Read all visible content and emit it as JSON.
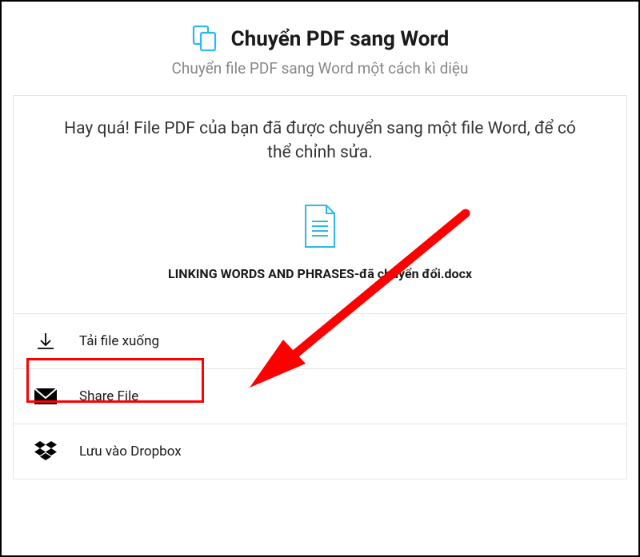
{
  "header": {
    "title": "Chuyển PDF sang Word",
    "subtitle": "Chuyển file PDF sang Word một cách kì diệu"
  },
  "content": {
    "success_message": "Hay quá! File PDF của bạn đã được chuyển sang một file Word, để có thể chỉnh sửa.",
    "converted_file_name": "LINKING WORDS AND PHRASES-đã chuyển đổi.docx"
  },
  "actions": {
    "download": "Tải file xuống",
    "share": "Share File",
    "dropbox": "Lưu vào Dropbox"
  },
  "colors": {
    "accent": "#2bbaf0",
    "highlight": "#ff0000"
  }
}
